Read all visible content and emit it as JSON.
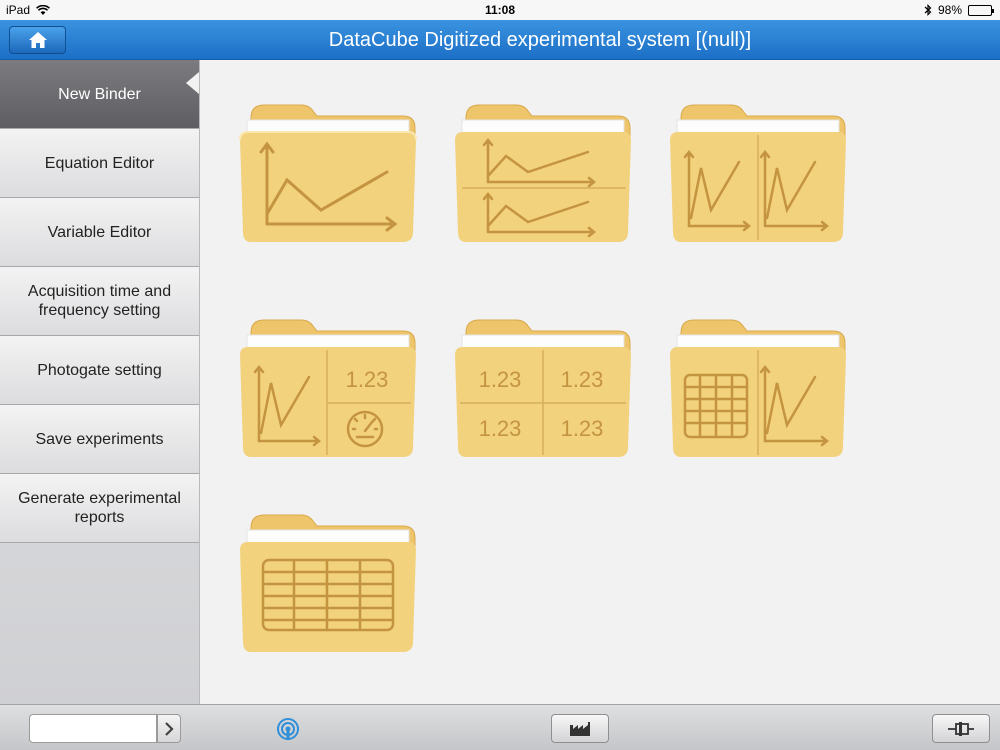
{
  "status": {
    "device": "iPad",
    "time": "11:08",
    "battery": "98%"
  },
  "nav": {
    "title": "DataCube Digitized experimental system   [(null)]"
  },
  "sidebar": {
    "items": [
      {
        "label": "New Binder",
        "active": true
      },
      {
        "label": "Equation Editor"
      },
      {
        "label": "Variable Editor"
      },
      {
        "label": "Acquisition time and frequency setting"
      },
      {
        "label": "Photogate setting"
      },
      {
        "label": "Save experiments"
      },
      {
        "label": "Generate experimental reports"
      }
    ]
  },
  "binders": [
    {
      "layout": "single-line-chart"
    },
    {
      "layout": "two-line-charts-stacked"
    },
    {
      "layout": "two-line-charts-side-by-side"
    },
    {
      "layout": "chart-number-gauge",
      "number": "1.23"
    },
    {
      "layout": "four-numbers",
      "numbers": [
        "1.23",
        "1.23",
        "1.23",
        "1.23"
      ]
    },
    {
      "layout": "table-and-chart"
    },
    {
      "layout": "single-table"
    }
  ],
  "toolbar": {
    "input_value": ""
  },
  "colors": {
    "nav": "#1c6fc6",
    "folder": "#f3d27e",
    "folder_line": "#c49440",
    "active_item": "#6b6b6f"
  }
}
